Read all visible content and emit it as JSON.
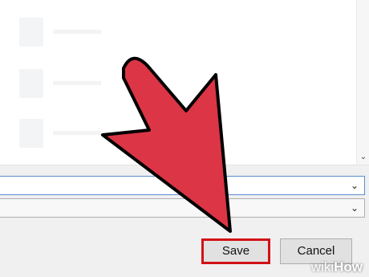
{
  "dialog": {
    "save_label": "Save",
    "cancel_label": "Cancel",
    "filename_value": "",
    "filetype_value": ""
  },
  "watermark": {
    "part1": "wiki",
    "part2": "How"
  },
  "icons": {
    "scroll_down": "chevron-down-icon",
    "dropdown": "chevron-down-icon"
  },
  "colors": {
    "arrow_fill": "#dc3545",
    "arrow_stroke": "#000000",
    "highlight": "#d21217"
  }
}
